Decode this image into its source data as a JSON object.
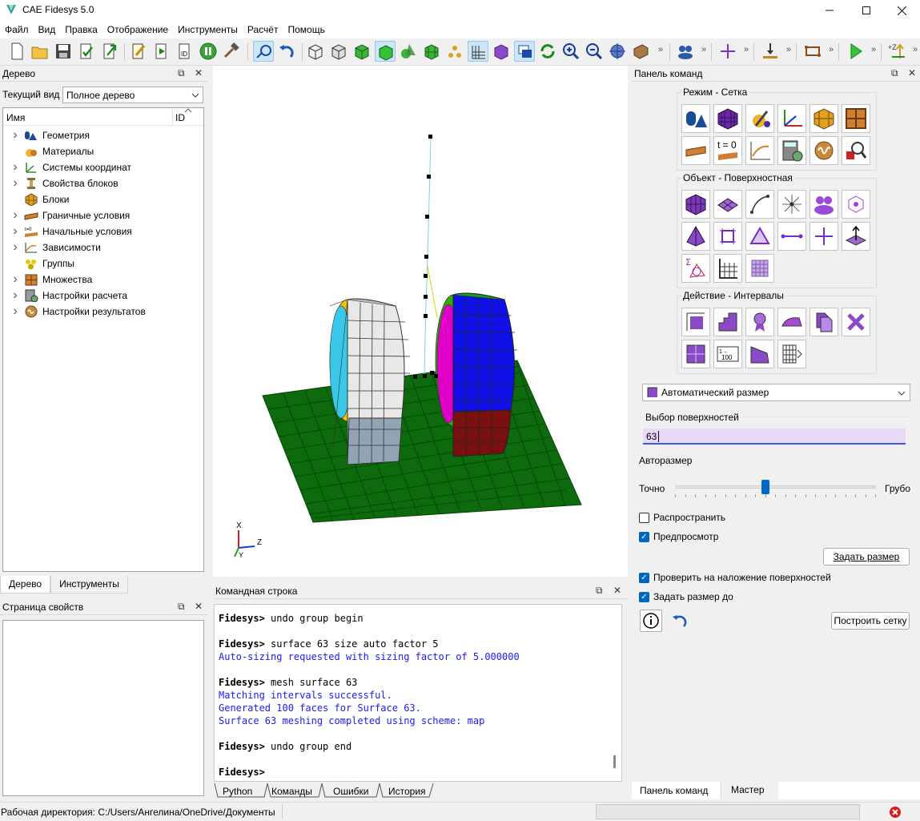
{
  "window": {
    "title": "CAE Fidesys 5.0"
  },
  "menu": [
    "Файл",
    "Вид",
    "Правка",
    "Отображение",
    "Инструменты",
    "Расчёт",
    "Помощь"
  ],
  "tree_panel": {
    "title": "Дерево",
    "view_label": "Текущий вид",
    "view_value": "Полное дерево",
    "col_name": "Имя",
    "col_id": "ID",
    "items": [
      {
        "label": "Геометрия",
        "expandable": true,
        "icon": "geometry-icon"
      },
      {
        "label": "Материалы",
        "expandable": false,
        "icon": "materials-icon"
      },
      {
        "label": "Системы координат",
        "expandable": true,
        "icon": "coordinate-systems-icon"
      },
      {
        "label": "Свойства блоков",
        "expandable": true,
        "icon": "block-properties-icon"
      },
      {
        "label": "Блоки",
        "expandable": false,
        "icon": "blocks-icon"
      },
      {
        "label": "Граничные условия",
        "expandable": true,
        "icon": "boundary-conditions-icon"
      },
      {
        "label": "Начальные условия",
        "expandable": true,
        "icon": "initial-conditions-icon"
      },
      {
        "label": "Зависимости",
        "expandable": true,
        "icon": "dependencies-icon"
      },
      {
        "label": "Группы",
        "expandable": false,
        "icon": "groups-icon"
      },
      {
        "label": "Множества",
        "expandable": true,
        "icon": "sets-icon"
      },
      {
        "label": "Настройки расчета",
        "expandable": true,
        "icon": "analysis-settings-icon"
      },
      {
        "label": "Настройки результатов",
        "expandable": true,
        "icon": "results-settings-icon"
      }
    ],
    "tabs": [
      "Дерево",
      "Инструменты"
    ]
  },
  "properties_panel": {
    "title": "Страница свойств"
  },
  "viewport": {
    "axes": {
      "x": "X",
      "y": "Y",
      "z": "Z"
    }
  },
  "command_panel_bottom": {
    "title": "Командная строка",
    "prompt": "Fidesys>",
    "lines": [
      {
        "type": "cmd",
        "text": "Fidesys> undo group begin"
      },
      {
        "type": "blank",
        "text": ""
      },
      {
        "type": "cmd",
        "text": "Fidesys> surface 63 size auto factor 5"
      },
      {
        "type": "out",
        "text": "Auto-sizing requested with sizing factor of 5.000000"
      },
      {
        "type": "blank",
        "text": ""
      },
      {
        "type": "cmd",
        "text": "Fidesys> mesh surface 63"
      },
      {
        "type": "out",
        "text": "Matching intervals successful."
      },
      {
        "type": "out",
        "text": "Generated 100 faces for Surface 63."
      },
      {
        "type": "out",
        "text": "Surface 63 meshing completed using scheme: map"
      },
      {
        "type": "blank",
        "text": ""
      },
      {
        "type": "cmd",
        "text": "Fidesys> undo group end"
      },
      {
        "type": "blank",
        "text": ""
      },
      {
        "type": "cmd",
        "text": "Fidesys>"
      }
    ],
    "tabs": [
      "Python",
      "Команды",
      "Ошибки",
      "История"
    ]
  },
  "command_panel_right": {
    "title": "Панель команд",
    "group_mode": "Режим - Сетка",
    "group_object": "Объект - Поверхностная",
    "group_action": "Действие - Интервалы",
    "dropdown": "Автоматический размер",
    "surface_select_label": "Выбор поверхностей",
    "surface_select_value": "63",
    "autosize_label": "Авторазмер",
    "slider_left": "Точно",
    "slider_right": "Грубо",
    "slider_value": 0.45,
    "propagate_label": "Распространить",
    "propagate_checked": false,
    "preview_label": "Предпросмотр",
    "preview_checked": true,
    "set_size_button": "Задать размер",
    "check_overlap_label": "Проверить на наложение поверхностей",
    "check_overlap_checked": true,
    "set_size_to_label": "Задать размер до",
    "set_size_to_checked": true,
    "mesh_button": "Построить сетку",
    "tabs": [
      "Панель команд",
      "Мастер"
    ]
  },
  "t0_text": "t = 0",
  "status_bar": {
    "workdir": "Рабочая директория: C:/Users/Ангелина/OneDrive/Документы"
  }
}
